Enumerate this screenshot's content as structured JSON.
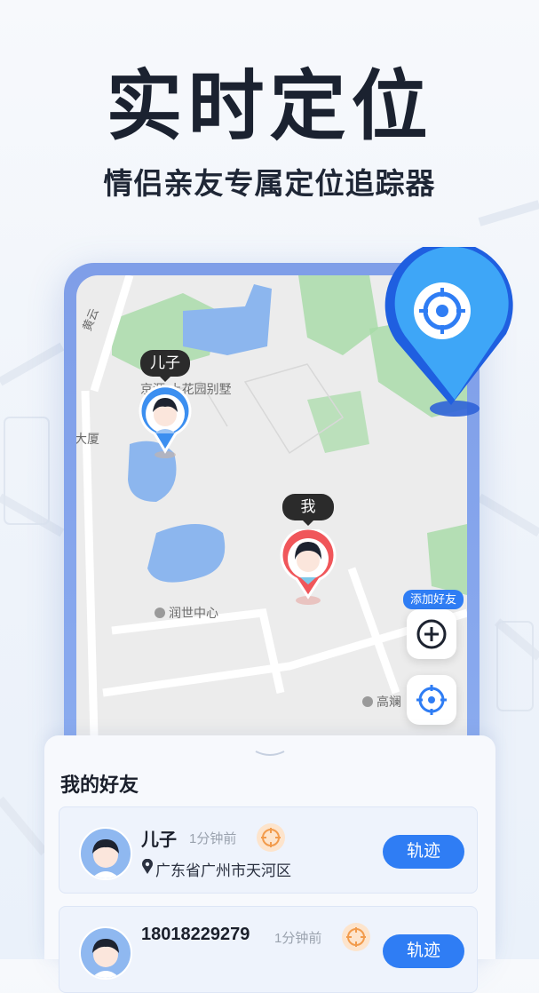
{
  "headline": "实时定位",
  "subtitle": "情侣亲友专属定位追踪器",
  "map": {
    "road_label": "黄云",
    "place_labels": [
      "京源·上花园别墅",
      "大厦",
      "润世中心",
      "高斓"
    ],
    "pins": [
      {
        "label": "儿子"
      },
      {
        "label": "我"
      }
    ],
    "add_friend_tag": "添加好友"
  },
  "colors": {
    "accent": "#2f7df4",
    "pin_blue": "#3c8ff0",
    "pin_red": "#f0565a"
  },
  "icons": {
    "locate_pin": "crosshair-pin-icon",
    "add": "plus-circle-icon",
    "locate": "crosshair-icon"
  },
  "friends": {
    "title": "我的好友",
    "items": [
      {
        "name": "儿子",
        "time": "1分钟前",
        "address": "广东省广州市天河区",
        "button": "轨迹"
      },
      {
        "name": "18018229279",
        "time": "1分钟前",
        "address": "",
        "button": "轨迹"
      }
    ]
  }
}
